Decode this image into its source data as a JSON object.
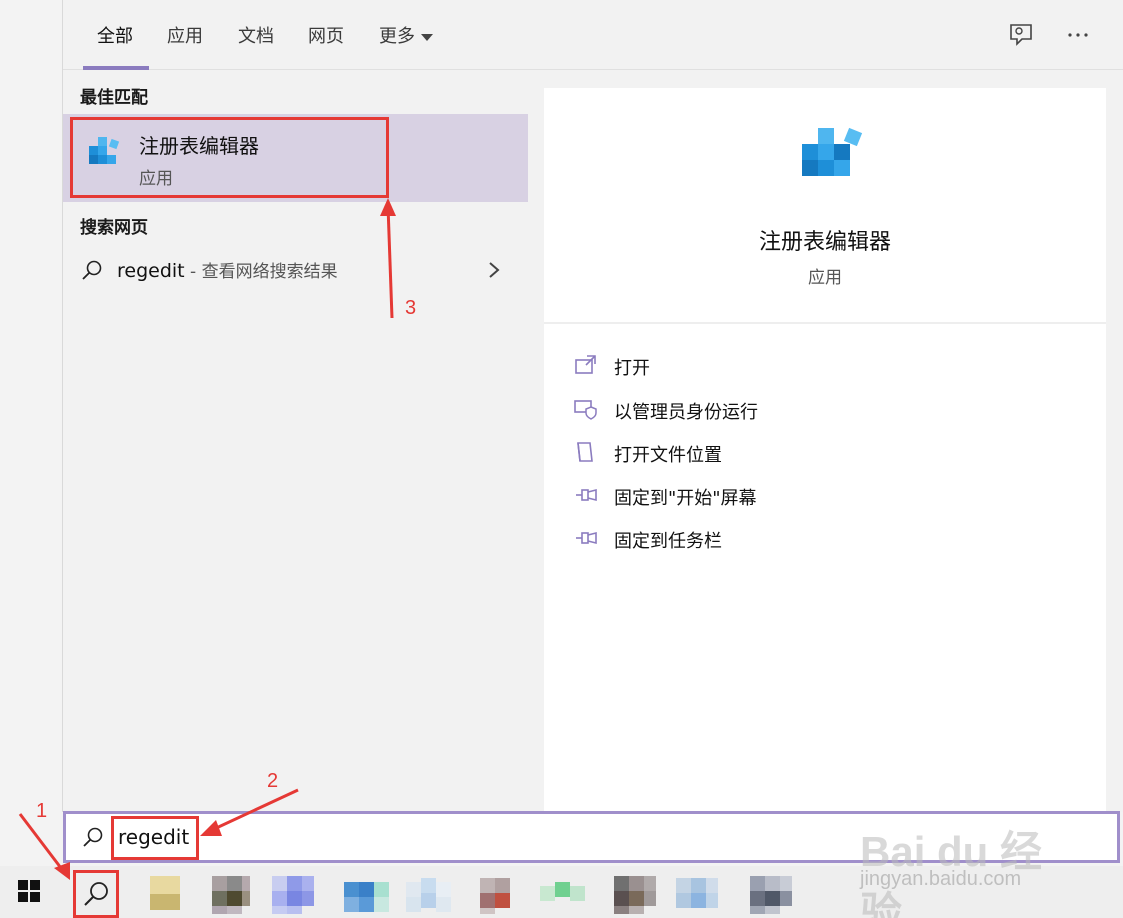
{
  "tabs": [
    {
      "label": "全部",
      "active": true
    },
    {
      "label": "应用",
      "active": false
    },
    {
      "label": "文档",
      "active": false
    },
    {
      "label": "网页",
      "active": false
    },
    {
      "label": "更多",
      "active": false
    }
  ],
  "header_icons": [
    "feedback-icon",
    "more-options-icon"
  ],
  "left": {
    "best_match_heading": "最佳匹配",
    "best_match": {
      "title": "注册表编辑器",
      "subtitle": "应用",
      "icon": "regedit-icon"
    },
    "web_heading": "搜索网页",
    "web_result": {
      "query": "regedit",
      "suffix": " - 查看网络搜索结果"
    }
  },
  "detail": {
    "title": "注册表编辑器",
    "subtitle": "应用",
    "actions": [
      {
        "label": "打开",
        "icon": "open-icon"
      },
      {
        "label": "以管理员身份运行",
        "icon": "run-as-admin-icon"
      },
      {
        "label": "打开文件位置",
        "icon": "file-location-icon"
      },
      {
        "label": "固定到\"开始\"屏幕",
        "icon": "pin-icon"
      },
      {
        "label": "固定到任务栏",
        "icon": "pin-icon"
      }
    ]
  },
  "search": {
    "value": "regedit"
  },
  "annotations": [
    "1",
    "2",
    "3"
  ],
  "watermark": {
    "brand": "Bai du 经验",
    "url": "jingyan.baidu.com"
  },
  "colors": {
    "accent": "#8b7cbf",
    "selection": "#d8d1e3",
    "annotation": "#e53935"
  }
}
